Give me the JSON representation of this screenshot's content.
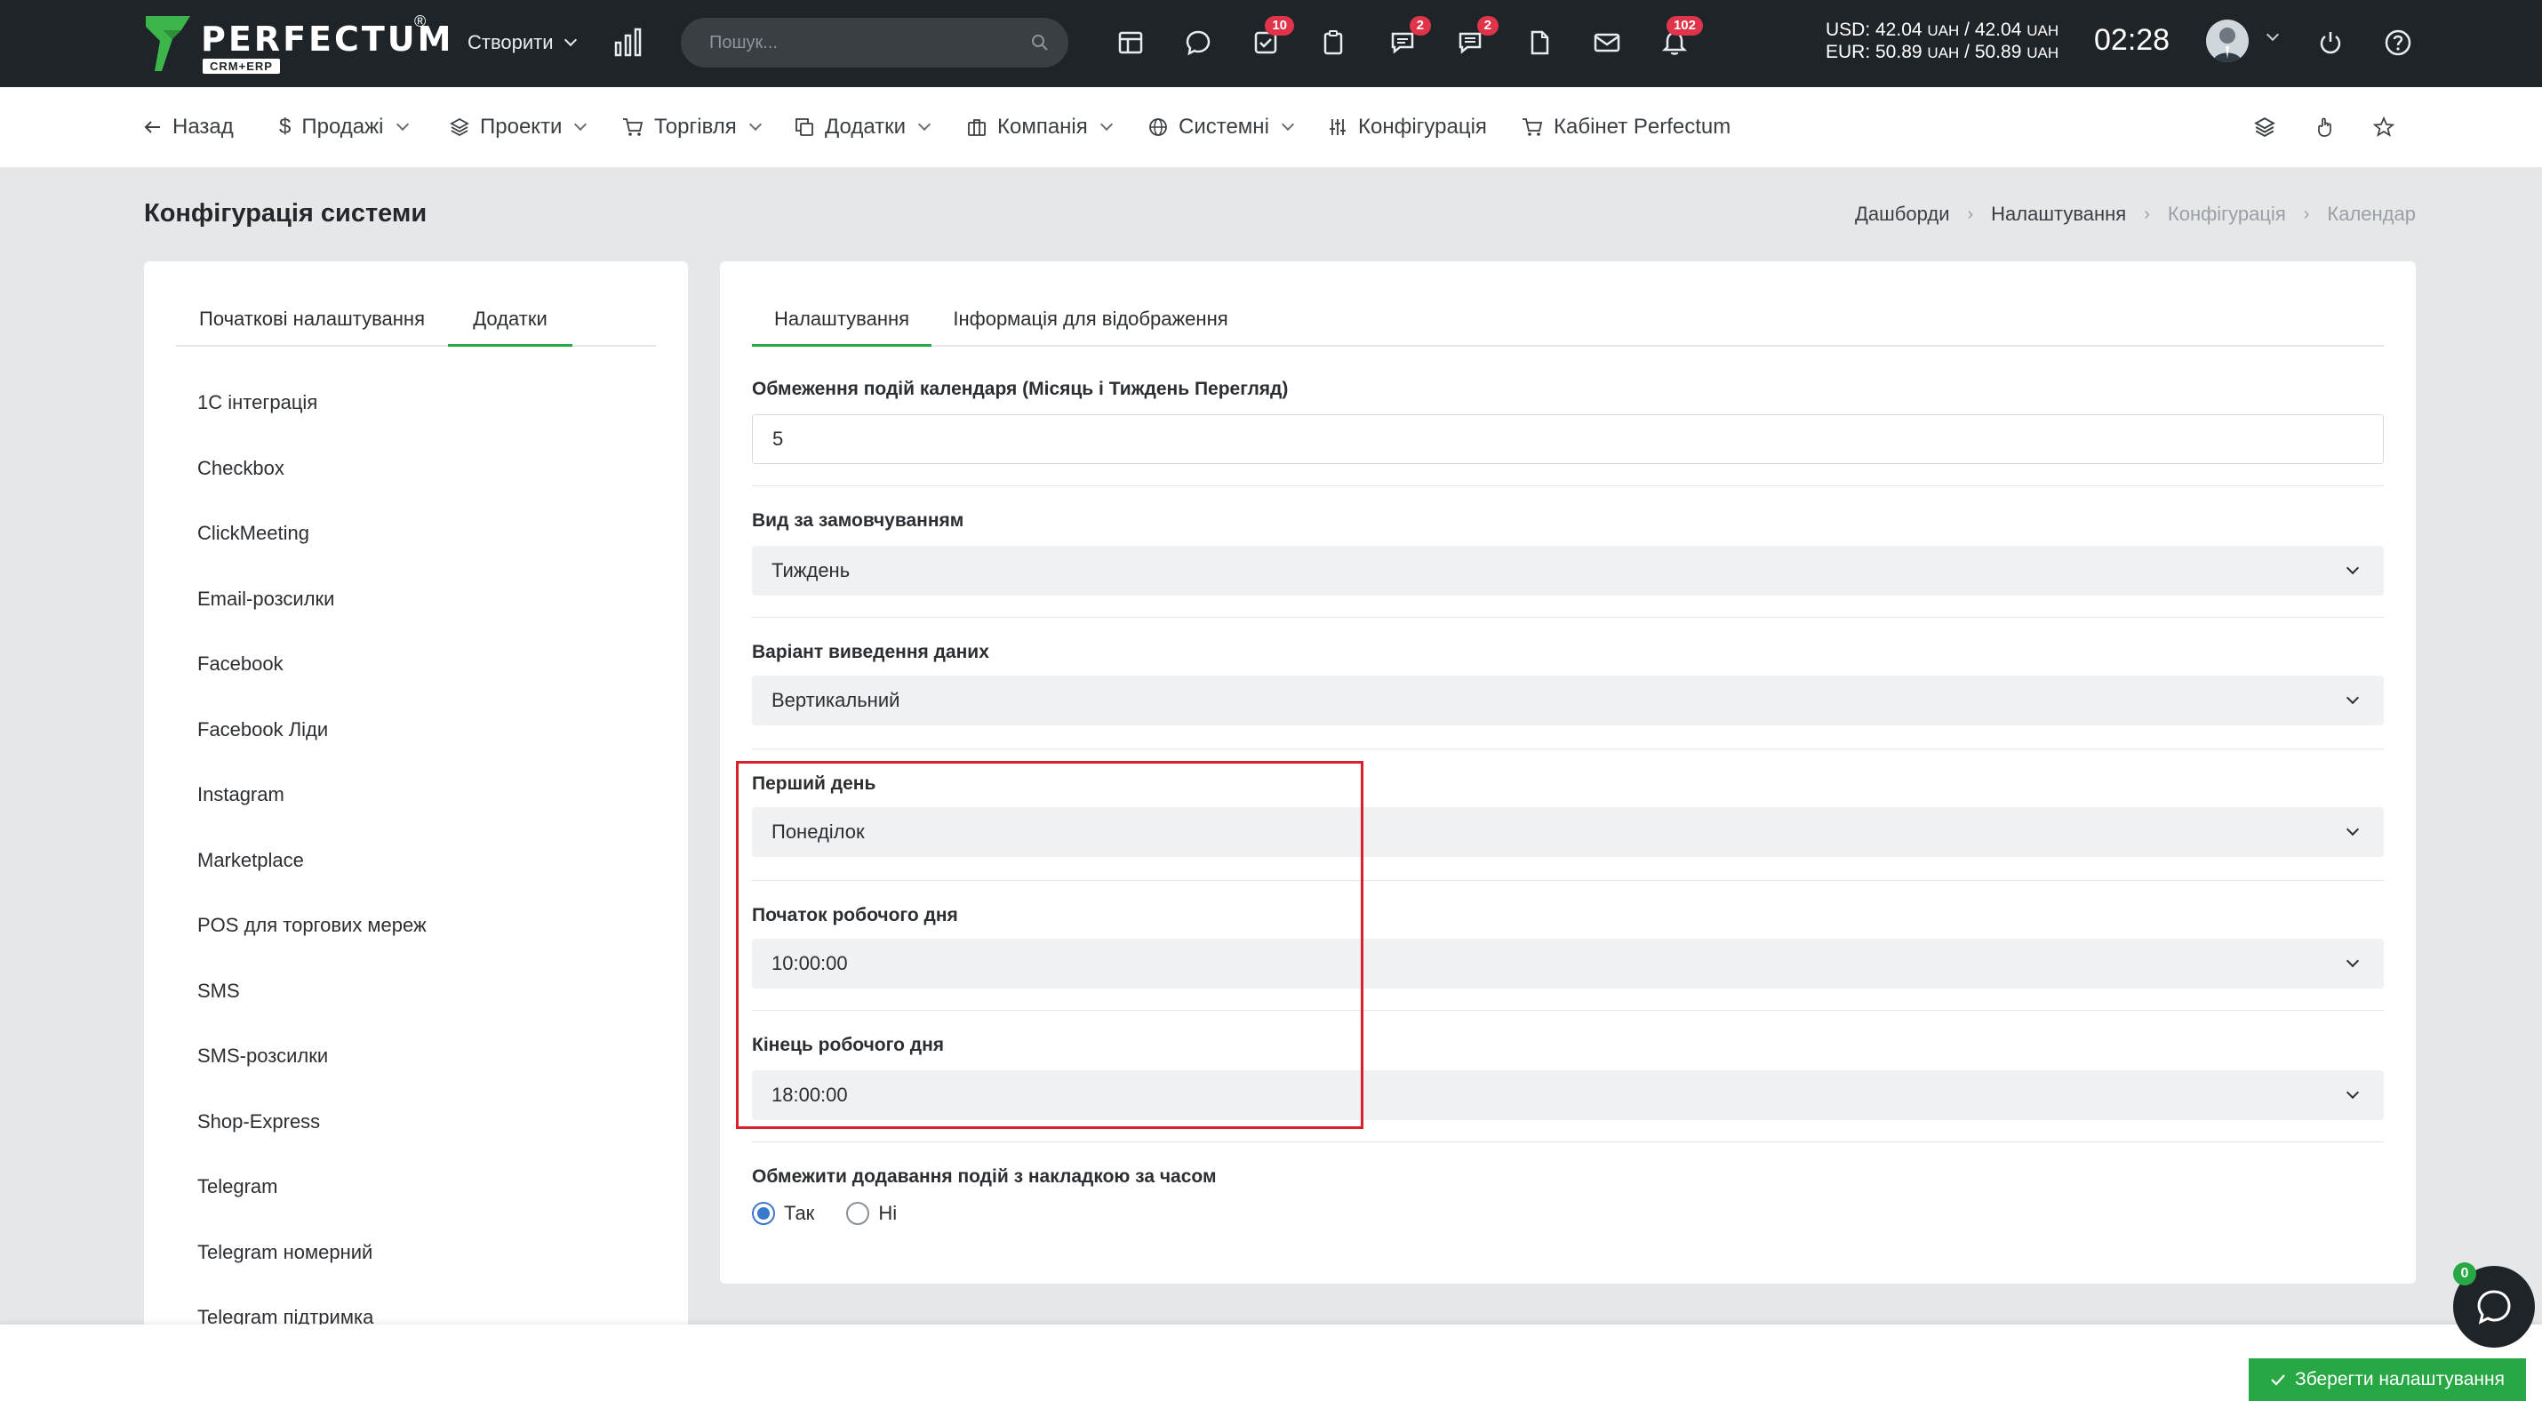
{
  "topbar": {
    "logo_text": "PERFECTUM",
    "logo_sub": "CRM+ERP",
    "logo_reg": "®",
    "create_label": "Створити",
    "search_placeholder": "Пошук...",
    "badges": {
      "tasks": "10",
      "chats": "2",
      "notes": "2",
      "bell": "102"
    },
    "rate_usd": "USD: 42.04",
    "rate_usd_unit1": "UAH",
    "rate_usd_mid": " / 42.04",
    "rate_usd_unit2": "UAH",
    "rate_eur": "EUR: 50.89",
    "rate_eur_unit1": "UAH",
    "rate_eur_mid": " / 50.89",
    "rate_eur_unit2": "UAH",
    "clock": "02:28"
  },
  "subnav": {
    "back": "Назад",
    "sales": "Продажі",
    "projects": "Проекти",
    "trade": "Торгівля",
    "addons": "Додатки",
    "company": "Компанія",
    "system": "Системні",
    "config": "Конфігурація",
    "cabinet": "Кабінет Perfectum"
  },
  "page": {
    "title": "Конфігурація системи",
    "breadcrumb": [
      "Дашборди",
      "Налаштування",
      "Конфігурація",
      "Календар"
    ]
  },
  "left": {
    "tabs": [
      "Початкові налаштування",
      "Додатки"
    ],
    "items": [
      "1C інтеграція",
      "Checkbox",
      "ClickMeeting",
      "Email-розсилки",
      "Facebook",
      "Facebook Ліди",
      "Instagram",
      "Marketplace",
      "POS для торгових мереж",
      "SMS",
      "SMS-розсилки",
      "Shop-Express",
      "Telegram",
      "Telegram номерний",
      "Telegram підтримка"
    ]
  },
  "right": {
    "tabs": [
      "Налаштування",
      "Інформація для відображення"
    ],
    "limit_label": "Обмеження подій календаря (Місяць і Тиждень Перегляд)",
    "limit_value": "5",
    "default_view_label": "Вид за замовчуванням",
    "default_view_value": "Тиждень",
    "output_label": "Варіант виведення даних",
    "output_value": "Вертикальний",
    "first_day_label": "Перший день",
    "first_day_value": "Понеділок",
    "start_label": "Початок робочого дня",
    "start_value": "10:00:00",
    "end_label": "Кінець робочого дня",
    "end_value": "18:00:00",
    "overlap_label": "Обмежити додавання подій з накладкою за часом",
    "yes": "Так",
    "no": "Ні"
  },
  "footer": {
    "save_label": "Зберегти налаштування",
    "chat_badge": "0"
  },
  "colors": {
    "topbar_bg": "#1f2428",
    "accent_green": "#28a745",
    "badge_red": "#e0344b",
    "highlight_red": "#d9202c",
    "radio_blue": "#3a78c9"
  }
}
